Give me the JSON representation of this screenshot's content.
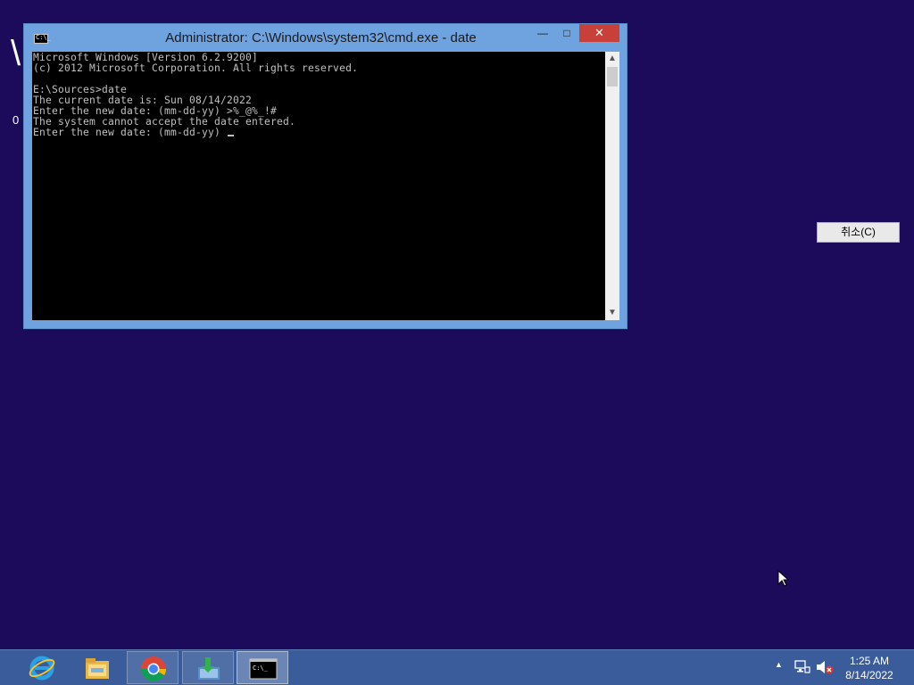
{
  "background": {
    "fragment_1": "\\",
    "fragment_2": "0"
  },
  "cmd_window": {
    "title": "Administrator: C:\\Windows\\system32\\cmd.exe - date",
    "icon_text": "C:\\_",
    "buttons": {
      "minimize": "—",
      "maximize": "□",
      "close": "✕"
    },
    "console_lines": [
      "Microsoft Windows [Version 6.2.9200]",
      "(c) 2012 Microsoft Corporation. All rights reserved.",
      "",
      "E:\\Sources>date",
      "The current date is: Sun 08/14/2022",
      "Enter the new date: (mm-dd-yy) >%_@%_!#",
      "The system cannot accept the date entered.",
      "Enter the new date: (mm-dd-yy) "
    ]
  },
  "dialog": {
    "cancel_label": "취소(C)"
  },
  "taskbar": {
    "apps": [
      "internet-explorer",
      "file-explorer",
      "chrome",
      "installer-app",
      "command-prompt"
    ],
    "tray_chevron": "▲",
    "clock_time": "1:25 AM",
    "clock_date": "8/14/2022"
  },
  "colors": {
    "desktop": "#1c0b5a",
    "taskbar": "#3a5c9b",
    "window_frame": "#6fa3e0",
    "close_button": "#c9403a"
  }
}
